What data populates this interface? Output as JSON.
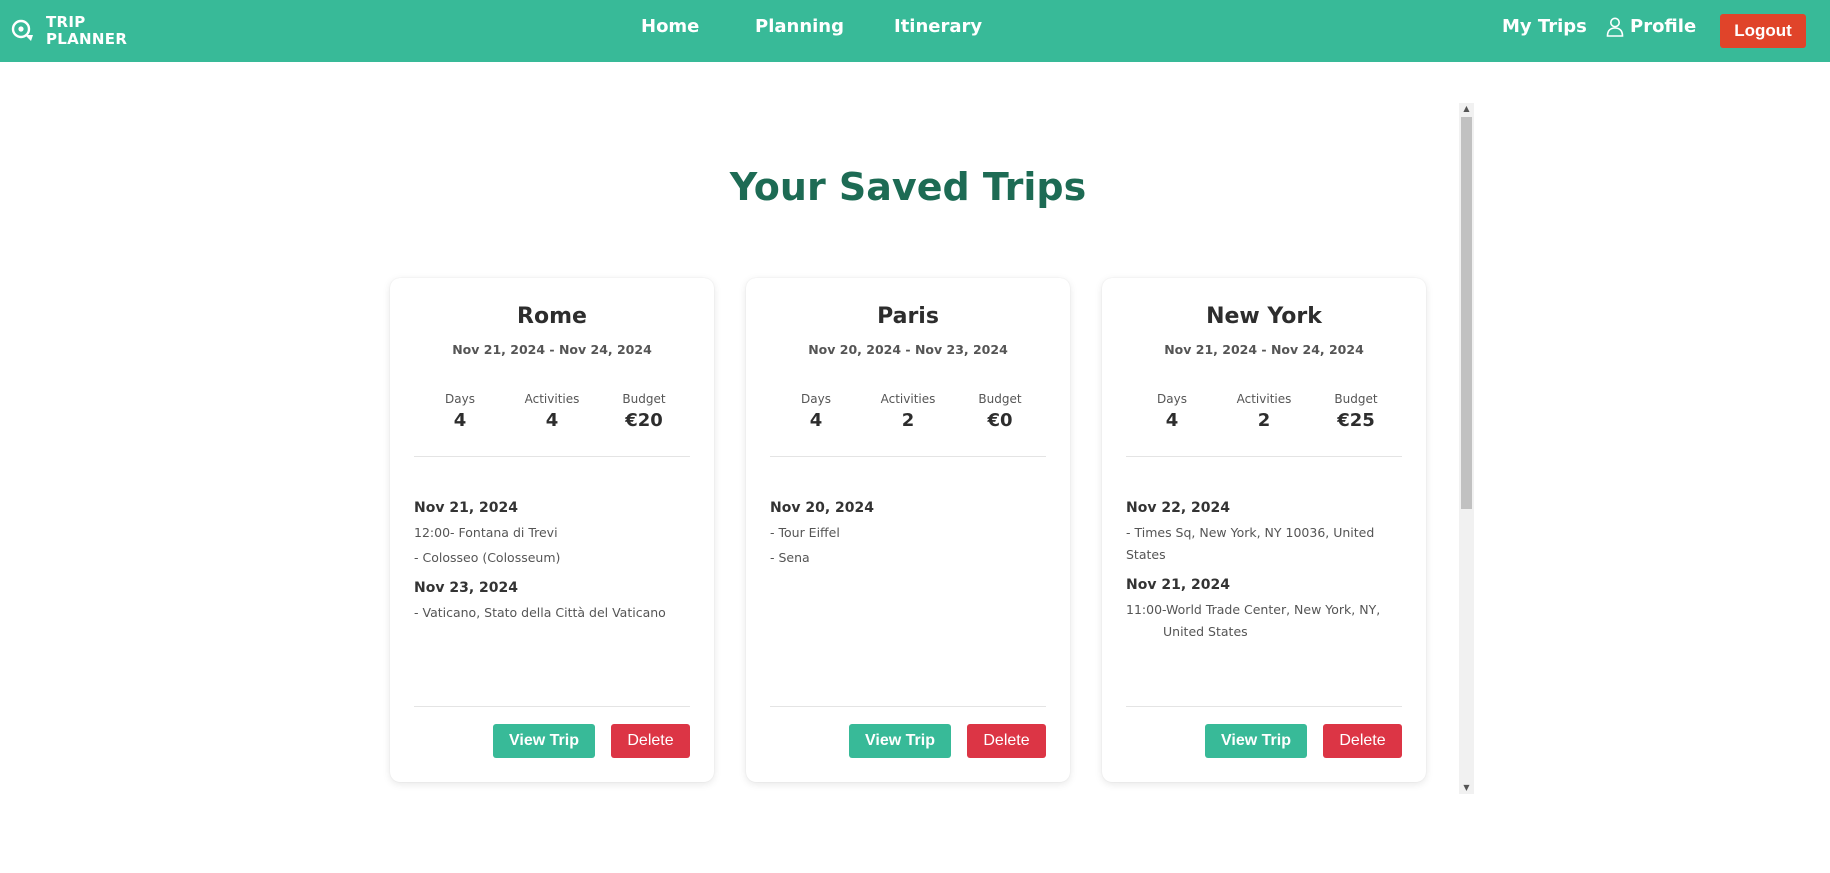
{
  "brand": {
    "line1": "TRIP",
    "line2": "PLANNER"
  },
  "nav": {
    "home": "Home",
    "planning": "Planning",
    "itinerary": "Itinerary",
    "my_trips": "My Trips",
    "profile": "Profile",
    "logout": "Logout"
  },
  "colors": {
    "primary": "#38ba98",
    "title": "#1d6b54",
    "logout": "#e0442a",
    "delete": "#dc3545"
  },
  "page_title": "Your Saved Trips",
  "stat_labels": {
    "days": "Days",
    "activities": "Activities",
    "budget": "Budget"
  },
  "trips": [
    {
      "city": "Rome",
      "dates": "Nov 21, 2024 - Nov 24, 2024",
      "days": "4",
      "activities": "4",
      "budget": "€20",
      "itinerary": [
        {
          "date": "Nov 21, 2024",
          "items": [
            "12:00- Fontana di Trevi",
            "- Colosseo (Colosseum)"
          ]
        },
        {
          "date": "Nov 23, 2024",
          "items": [
            "- Vaticano, Stato della Città del Vaticano"
          ]
        }
      ],
      "view_label": "View Trip",
      "delete_label": "Delete"
    },
    {
      "city": "Paris",
      "dates": "Nov 20, 2024 - Nov 23, 2024",
      "days": "4",
      "activities": "2",
      "budget": "€0",
      "itinerary": [
        {
          "date": "Nov 20, 2024",
          "items": [
            "- Tour Eiffel",
            "- Sena"
          ]
        }
      ],
      "view_label": "View Trip",
      "delete_label": "Delete"
    },
    {
      "city": "New York",
      "dates": "Nov 21, 2024 - Nov 24, 2024",
      "days": "4",
      "activities": "2",
      "budget": "€25",
      "itinerary": [
        {
          "date": "Nov 22, 2024",
          "items": [
            "- Times Sq, New York, NY 10036, United States"
          ]
        },
        {
          "date": "Nov 21, 2024",
          "items": [
            "11:00-World Trade Center, New York, NY, United States"
          ]
        }
      ],
      "view_label": "View Trip",
      "delete_label": "Delete"
    }
  ]
}
